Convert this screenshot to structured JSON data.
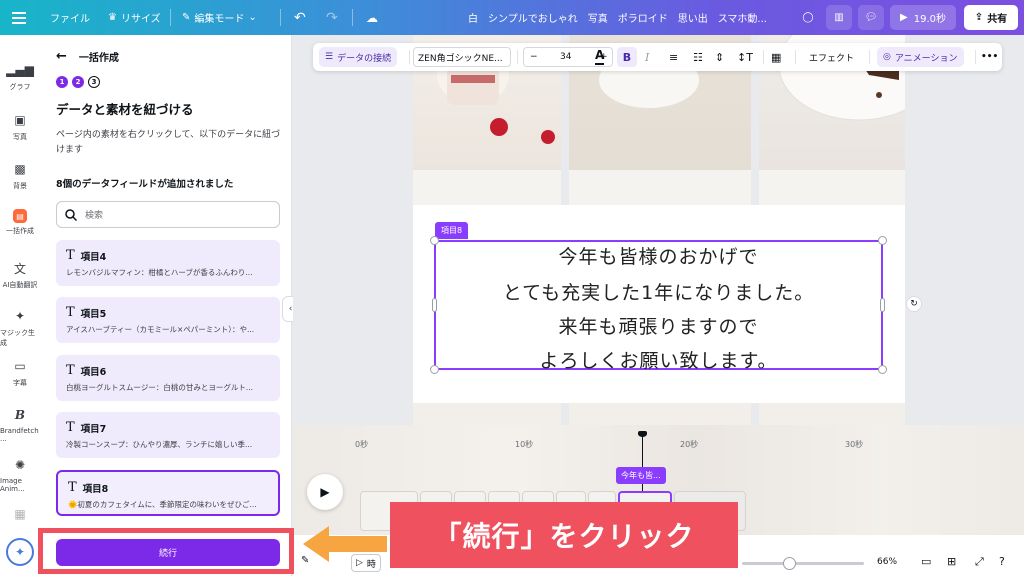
{
  "topbar": {
    "menu_icon": "menu-icon",
    "file": "ファイル",
    "resize": "リサイズ",
    "edit_mode": "編集モード",
    "doc_title": "白　シンプルでおしゃれ　写真　ポラロイド　思い出　スマホ動...",
    "duration": "19.0秒",
    "share": "共有"
  },
  "rail": [
    {
      "label": "グラフ",
      "icon": "chart-icon"
    },
    {
      "label": "写真",
      "icon": "photo-icon"
    },
    {
      "label": "背景",
      "icon": "background-icon"
    },
    {
      "label": "一括作成",
      "icon": "bulk-create-icon"
    },
    {
      "label": "AI自動翻訳",
      "icon": "translate-icon"
    },
    {
      "label": "マジック生成",
      "icon": "magic-media-icon"
    },
    {
      "label": "字幕",
      "icon": "captions-icon"
    },
    {
      "label": "Brandfetch ...",
      "icon": "brandfetch-icon"
    },
    {
      "label": "Image Anim...",
      "icon": "image-animate-icon"
    }
  ],
  "panel": {
    "back_title": "一括作成",
    "steps": [
      "1",
      "2",
      "3"
    ],
    "title": "データと素材を紐づける",
    "description": "ページ内の素材を右クリックして、以下のデータに紐づけます",
    "count": "8個のデータフィールドが追加されました",
    "search_placeholder": "検索",
    "fields": [
      {
        "name": "項目4",
        "value": "レモンバジルマフィン：柑橘とハーブが香るふんわり..."
      },
      {
        "name": "項目5",
        "value": "アイスハーブティー（カモミール×ペパーミント）：や..."
      },
      {
        "name": "項目6",
        "value": "白桃ヨーグルトスムージー：白桃の甘みとヨーグルト..."
      },
      {
        "name": "項目7",
        "value": "冷製コーンスープ：ひんやり濃厚、ランチに嬉しい季..."
      },
      {
        "name": "項目8",
        "value": "🌞初夏のカフェタイムに、季節限定の味わいをぜひご..."
      }
    ],
    "continue": "続行"
  },
  "toolbar": {
    "data_connect": "データの接続",
    "font": "ZEN角ゴシックNE...",
    "minus": "−",
    "font_size": "34",
    "plus": "+",
    "bold": "B",
    "italic": "I",
    "effects": "エフェクト",
    "animation": "アニメーション",
    "more": "•••"
  },
  "canvas": {
    "selection_label": "項目8",
    "text_lines": [
      "今年も皆様のおかげで",
      "とても充実した1年になりました。",
      "来年も頑張りますので",
      "よろしくお願い致します。"
    ]
  },
  "timeline": {
    "ruler": [
      "0秒",
      "10秒",
      "20秒",
      "30秒"
    ],
    "clip_tag": "今年も皆...",
    "zoom": "66%",
    "time_label": "時"
  },
  "callout": {
    "text": "「続行」をクリック"
  },
  "colors": {
    "accent": "#7d2ae8",
    "callout": "#f0515e",
    "arrow": "#f6a540"
  }
}
